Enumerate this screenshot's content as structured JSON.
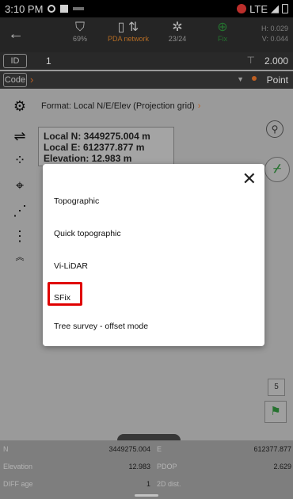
{
  "status_bar": {
    "time": "3:10 PM",
    "network": "LTE"
  },
  "toolbar": {
    "battery": "69%",
    "network_label": "PDA network",
    "satellites": "23/24",
    "fix_label": "Fix",
    "h_precision": "H: 0.029",
    "v_precision": "V: 0.044"
  },
  "id_row": {
    "label": "ID",
    "value": "1",
    "height": "2.000"
  },
  "code_row": {
    "label": "Code",
    "point_label": "Point"
  },
  "format_label": "Format: Local N/E/Elev (Projection grid)",
  "coords": {
    "n": "Local N: 3449275.004 m",
    "e": "Local E: 612377.877 m",
    "elev": "Elevation: 12.983 m"
  },
  "side_num": "5",
  "bottom": {
    "rows": [
      {
        "label1": "N",
        "value1": "3449275.004",
        "label2": "E",
        "value2": "612377.877"
      },
      {
        "label1": "Elevation",
        "value1": "12.983",
        "label2": "PDOP",
        "value2": "2.629"
      },
      {
        "label1": "DIFF age",
        "value1": "1",
        "label2": "2D dist.",
        "value2": ""
      }
    ]
  },
  "dialog": {
    "options": [
      "Topographic",
      "Quick topographic",
      "Vi-LiDAR",
      "SFix",
      "Tree survey - offset mode"
    ],
    "close_icon": "close-icon"
  },
  "colors": {
    "accent_orange": "#e8742a",
    "highlight_red": "#e00000",
    "fix_green": "#2e8b3a"
  }
}
